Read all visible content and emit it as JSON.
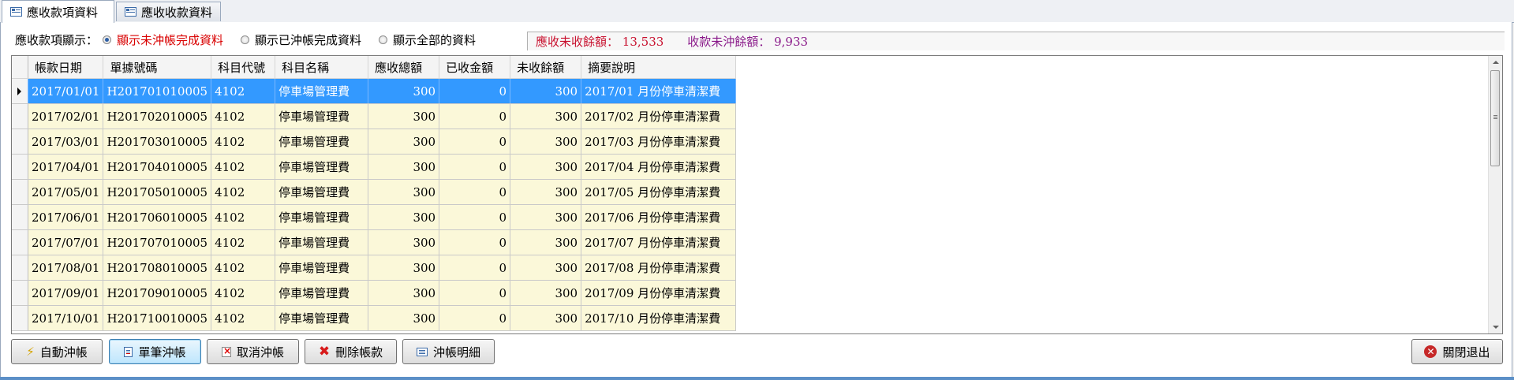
{
  "tabs": [
    {
      "label": "應收款項資料",
      "icon": "table-icon"
    },
    {
      "label": "應收收款資料",
      "icon": "table-icon"
    }
  ],
  "filter": {
    "label": "應收款項顯示：",
    "options": [
      {
        "label": "顯示未沖帳完成資料",
        "checked": true
      },
      {
        "label": "顯示已沖帳完成資料",
        "checked": false
      },
      {
        "label": "顯示全部的資料",
        "checked": false
      }
    ]
  },
  "summary": {
    "unreceived_label": "應收未收餘額：",
    "unreceived_value": "13,533",
    "unoffset_label": "收款未沖餘額：",
    "unoffset_value": "9,933"
  },
  "grid": {
    "columns": [
      "帳款日期",
      "單據號碼",
      "科目代號",
      "科目名稱",
      "應收總額",
      "已收金額",
      "未收餘額",
      "摘要說明"
    ],
    "rows": [
      [
        "2017/01/01",
        "H201701010005",
        "4102",
        "停車場管理費",
        "300",
        "0",
        "300",
        "2017/01 月份停車清潔費"
      ],
      [
        "2017/02/01",
        "H201702010005",
        "4102",
        "停車場管理費",
        "300",
        "0",
        "300",
        "2017/02 月份停車清潔費"
      ],
      [
        "2017/03/01",
        "H201703010005",
        "4102",
        "停車場管理費",
        "300",
        "0",
        "300",
        "2017/03 月份停車清潔費"
      ],
      [
        "2017/04/01",
        "H201704010005",
        "4102",
        "停車場管理費",
        "300",
        "0",
        "300",
        "2017/04 月份停車清潔費"
      ],
      [
        "2017/05/01",
        "H201705010005",
        "4102",
        "停車場管理費",
        "300",
        "0",
        "300",
        "2017/05 月份停車清潔費"
      ],
      [
        "2017/06/01",
        "H201706010005",
        "4102",
        "停車場管理費",
        "300",
        "0",
        "300",
        "2017/06 月份停車清潔費"
      ],
      [
        "2017/07/01",
        "H201707010005",
        "4102",
        "停車場管理費",
        "300",
        "0",
        "300",
        "2017/07 月份停車清潔費"
      ],
      [
        "2017/08/01",
        "H201708010005",
        "4102",
        "停車場管理費",
        "300",
        "0",
        "300",
        "2017/08 月份停車清潔費"
      ],
      [
        "2017/09/01",
        "H201709010005",
        "4102",
        "停車場管理費",
        "300",
        "0",
        "300",
        "2017/09 月份停車清潔費"
      ],
      [
        "2017/10/01",
        "H201710010005",
        "4102",
        "停車場管理費",
        "300",
        "0",
        "300",
        "2017/10 月份停車清潔費"
      ]
    ],
    "selected_row": 0
  },
  "buttons": {
    "auto_offset": "自動沖帳",
    "single_offset": "單筆沖帳",
    "cancel_offset": "取消沖帳",
    "delete_entry": "刪除帳款",
    "offset_detail": "沖帳明細",
    "close_exit": "關閉退出"
  },
  "colors": {
    "selected_row": "#3399ff",
    "row_background": "#fbf8d9",
    "radio_checked_text": "#d90000",
    "summary_unreceived": "#c8102e",
    "summary_unoffset": "#8a1a8a"
  }
}
